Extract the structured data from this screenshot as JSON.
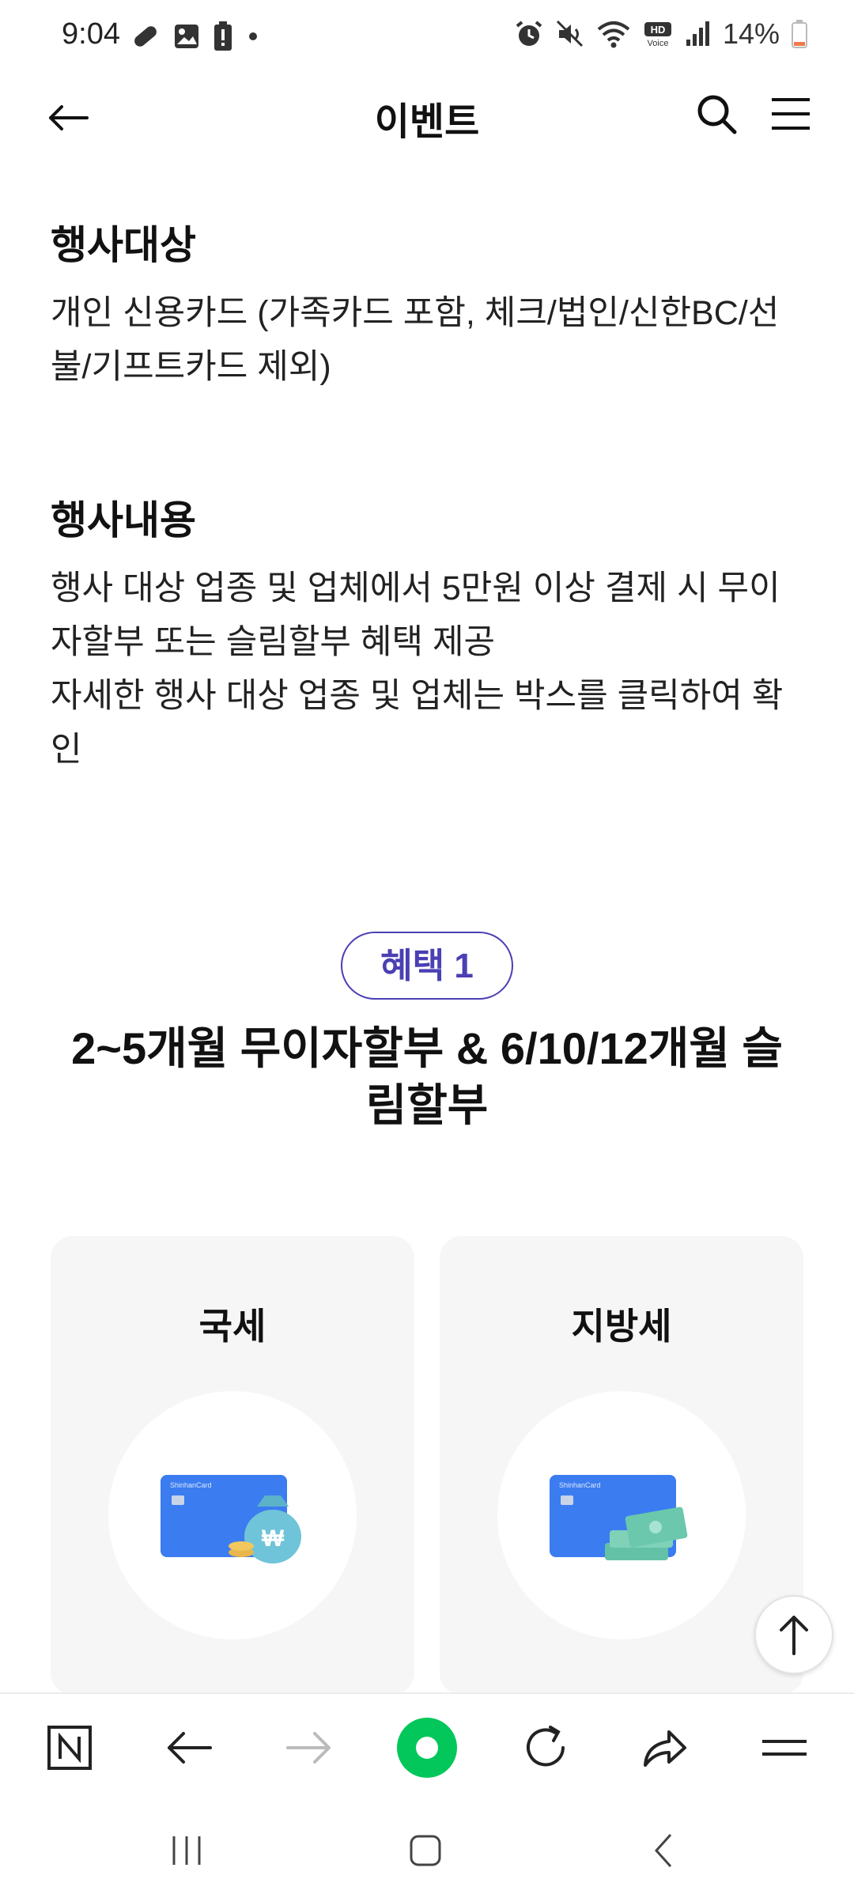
{
  "status_bar": {
    "time": "9:04",
    "battery": "14%",
    "left_icons": [
      "pill-icon",
      "image-icon",
      "battery-alert-icon",
      "dot-icon"
    ],
    "right_icons": [
      "alarm-icon",
      "mute-icon",
      "wifi-icon",
      "hd-voice-icon",
      "signal-icon",
      "battery-icon"
    ]
  },
  "header": {
    "title": "이벤트"
  },
  "sections": [
    {
      "title": "행사대상",
      "body": "개인 신용카드 (가족카드 포함, 체크/법인/신한BC/선불/기프트카드 제외)"
    },
    {
      "title": "행사내용",
      "body_line1": "행사 대상 업종 및 업체에서 5만원 이상 결제 시 무이자할부 또는 슬림할부 혜택 제공",
      "body_line2": "자세한 행사 대상 업종 및 업체는 박스를 클릭하여 확인"
    }
  ],
  "benefit": {
    "badge": "혜택 1",
    "title": "2~5개월 무이자할부 & 6/10/12개월 슬림할부"
  },
  "cards": [
    {
      "label": "국세",
      "icon": "card-money-bag-icon"
    },
    {
      "label": "지방세",
      "icon": "card-cash-stack-icon"
    }
  ],
  "colors": {
    "accent": "#4a3fb3",
    "card_bg": "#f6f6f6",
    "card_blue": "#3b7cf0",
    "naver_green": "#03c75a"
  }
}
